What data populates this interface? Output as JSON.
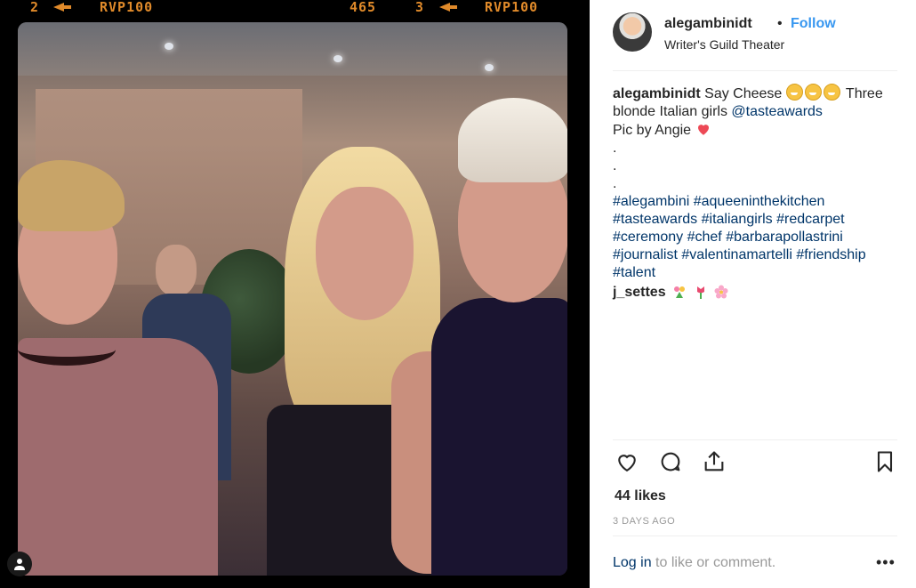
{
  "film": {
    "left_frame": "2",
    "left_code": "RVP100",
    "counter": "465",
    "right_frame": "3",
    "right_code": "RVP100",
    "color": "#e08a2a"
  },
  "post": {
    "author": "alegambinidt",
    "follow_label": "Follow",
    "location": "Writer's Guild Theater",
    "caption": {
      "text_intro": "Say Cheese",
      "text_after_emoji": "Three blonde Italian girls",
      "mention": "@tasteawards",
      "line2": "Pic by Angie",
      "dots": [
        ".",
        ".",
        "."
      ],
      "hashtags": [
        "#alegambini",
        "#aqueeninthekitchen",
        "#tasteawards",
        "#italiangirls",
        "#redcarpet",
        "#ceremony",
        "#chef",
        "#barbarapollastrini",
        "#journalist",
        "#valentinamartelli",
        "#friendship",
        "#talent"
      ]
    },
    "comment": {
      "author": "j_settes"
    },
    "likes": "44 likes",
    "time": "3 DAYS AGO",
    "login_link": "Log in",
    "login_rest": " to like or comment.",
    "more_label": "•••"
  },
  "colors": {
    "accent": "#3897f0",
    "link": "#003569",
    "muted": "#999999",
    "heart": "#ed4956"
  },
  "icons": [
    "like-icon",
    "comment-icon",
    "share-icon",
    "save-icon",
    "user-tag-icon"
  ]
}
